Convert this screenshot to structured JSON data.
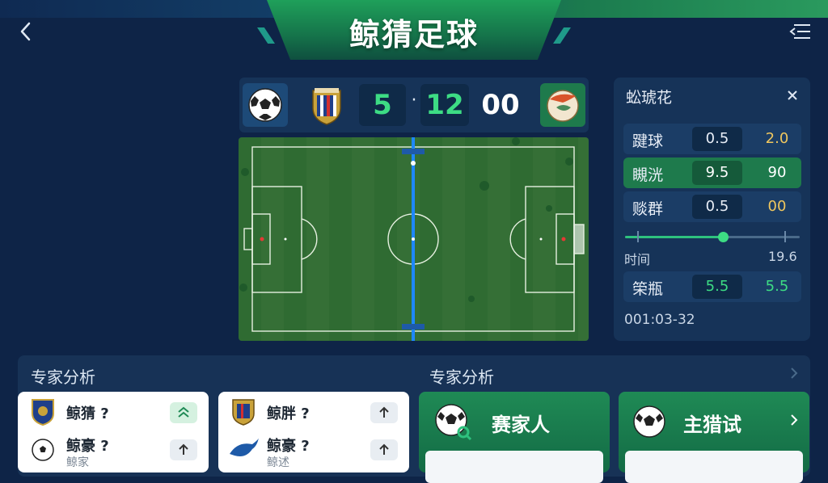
{
  "header": {
    "title": "鲸猜足球",
    "back_icon": "back-arrow-icon",
    "menu_icon": "menu-icon"
  },
  "scoreboard": {
    "home_score": "5",
    "separator": "·",
    "minute": "12",
    "seconds": "00",
    "home_score_color": "#3ddc84",
    "minute_color": "#3ddc84"
  },
  "panel": {
    "title": "蚣琥花",
    "rows": [
      {
        "label": "踺球",
        "left": "0.5",
        "right": "2.0"
      },
      {
        "label": "瞡洸",
        "left": "9.5",
        "right": "90"
      },
      {
        "label": "赕群",
        "left": "0.5",
        "right": "00"
      }
    ],
    "time_label": "时间",
    "time_value": "19.6",
    "slider_value": 0.56,
    "extra_row": {
      "label": "筞瓶",
      "left": "5.5",
      "right": "5.5"
    },
    "timestamp": "001:03-32"
  },
  "expert": {
    "title_left": "专家分析",
    "title_center": "专家分析",
    "cards": [
      {
        "line1": "鲸猜 ?",
        "line2": "鲸豪 ?",
        "sub": "鲸家"
      },
      {
        "line1": "鲸胖 ?",
        "line2": "鲸豪 ?",
        "sub": "鲸述"
      }
    ],
    "green_cards": [
      {
        "title": "赛家人"
      },
      {
        "title": "主猎试"
      }
    ]
  },
  "colors": {
    "background": "#0e2447",
    "accent_green": "#2ec27e",
    "panel": "#163358"
  }
}
